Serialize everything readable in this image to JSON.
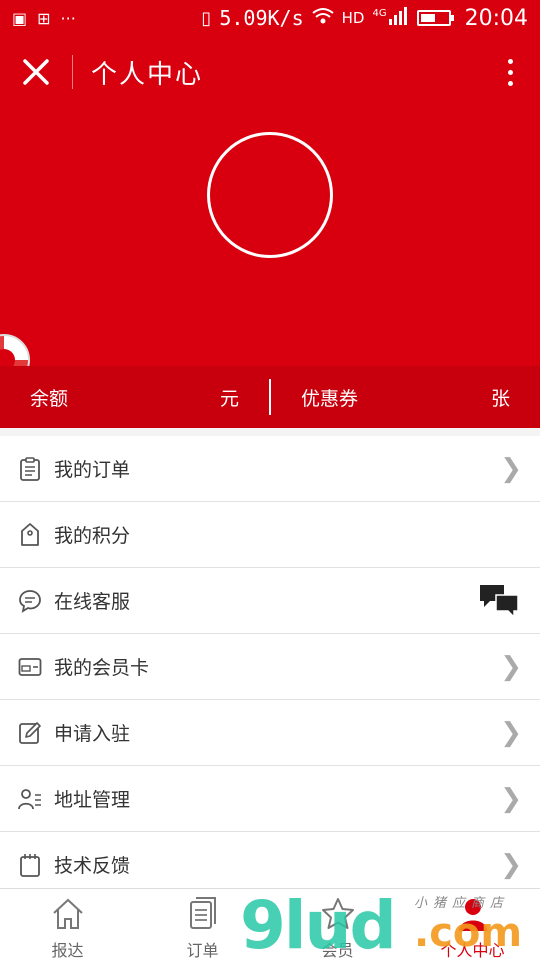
{
  "status_bar": {
    "net_speed": "5.09K/s",
    "signal_label": "HD",
    "network_type": "4G",
    "battery_level": 0.55,
    "time": "20:04"
  },
  "header": {
    "title": "个人中心",
    "accent_color": "#d8000f"
  },
  "balance": {
    "balance_label": "余额",
    "balance_unit": "元",
    "coupon_label": "优惠券",
    "coupon_unit": "张"
  },
  "menu": {
    "items": [
      {
        "label": "我的订单",
        "icon": "clipboard-icon"
      },
      {
        "label": "我的积分",
        "icon": "tag-icon"
      },
      {
        "label": "在线客服",
        "icon": "chat-bubble-icon"
      },
      {
        "label": "我的会员卡",
        "icon": "card-icon"
      },
      {
        "label": "申请入驻",
        "icon": "edit-icon"
      },
      {
        "label": "地址管理",
        "icon": "address-icon"
      },
      {
        "label": "技术反馈",
        "icon": "calendar-icon"
      }
    ]
  },
  "tabs": [
    {
      "label": "报达",
      "icon": "home-icon"
    },
    {
      "label": "订单",
      "icon": "document-icon"
    },
    {
      "label": "会员",
      "icon": "star-icon"
    },
    {
      "label": "个人中心",
      "icon": "user-icon",
      "active": true
    }
  ],
  "watermark": {
    "main": "9lud",
    "domain": ".com",
    "sub": "小猪应商店"
  }
}
